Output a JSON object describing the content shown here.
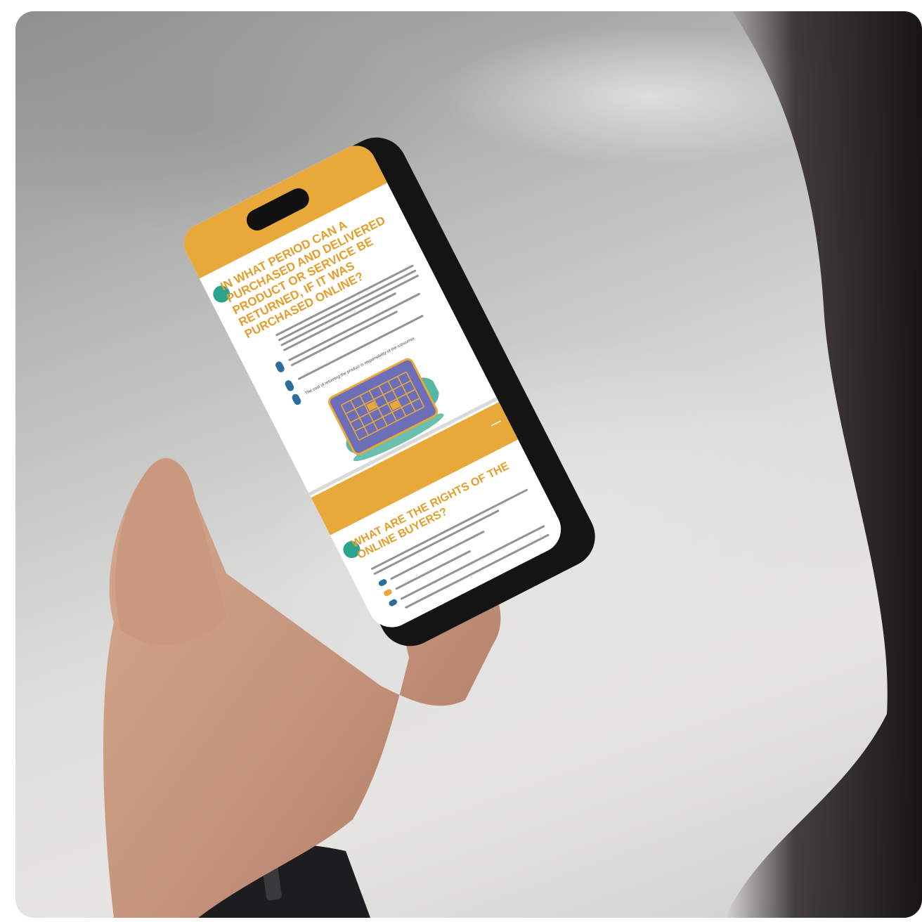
{
  "photo": {
    "subject": "hand holding smartphone",
    "colors": {
      "accent": "#e8a93a",
      "teal": "#2aa58c",
      "calendar": "#6c6fb8",
      "phone_frame": "#141414",
      "skin": "#c99a7c"
    }
  },
  "phone_screen": {
    "section1": {
      "title": "IN WHAT PERIOD CAN A PURCHASED AND DELIVERED PRODUCT OR SERVICE BE RETURNED, IF IT WAS PURCHASED ONLINE?",
      "bullet3": "The cost of returning the product is responsibility of the consumer."
    },
    "section2": {
      "title": "WHAT ARE THE RIGHTS OF THE ONLINE BUYERS?"
    }
  }
}
